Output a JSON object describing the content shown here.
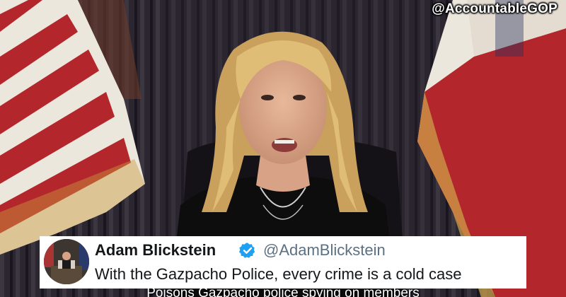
{
  "watermark": "@AccountableGOP",
  "caption": "Poisons Gazpacho police spying on members",
  "tweet": {
    "display_name": "Adam Blickstein",
    "handle": "@AdamBlickstein",
    "text": "With the Gazpacho Police, every crime is a cold case",
    "verified_icon": "verified-badge-icon",
    "verified_color": "#1da1f2"
  },
  "colors": {
    "flag_red": "#b3262c",
    "flag_white": "#ece7dd",
    "flag_blue": "#23305e",
    "curtain": "#2a2430",
    "hair": "#d9b46a",
    "shirt": "#0d0d0d"
  }
}
